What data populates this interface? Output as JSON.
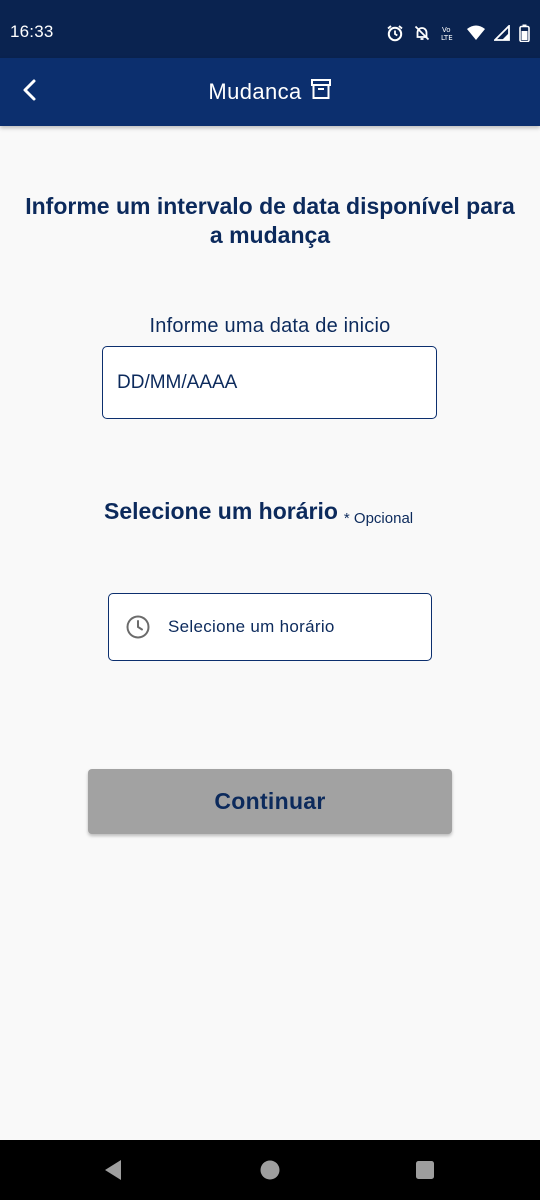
{
  "status_bar": {
    "time": "16:33",
    "icons": [
      "alarm-icon",
      "notifications-off-icon",
      "volte-icon",
      "wifi-icon",
      "signal-icon",
      "battery-icon"
    ]
  },
  "app_bar": {
    "title": "Mudanca",
    "back_icon": "chevron-left-icon",
    "title_icon": "archive-box-icon"
  },
  "main": {
    "heading": "Informe um intervalo de data disponível para a mudança",
    "start_date_label": "Informe uma data de inicio",
    "date_input": {
      "placeholder": "DD/MM/AAAA",
      "value": ""
    },
    "time_heading": "Selecione um horário",
    "optional_label": "* Opcional",
    "time_select": {
      "label": "Selecione um horário",
      "icon": "clock-icon"
    },
    "continue_button": "Continuar"
  },
  "colors": {
    "status_bar_bg": "#0a2350",
    "app_bar_bg": "#0c2f6e",
    "primary_text": "#0c2a5c",
    "disabled_button_bg": "#a2a2a2",
    "page_bg": "#f9f9f9"
  },
  "nav_bar": {
    "buttons": [
      "back-triangle-icon",
      "home-circle-icon",
      "recents-square-icon"
    ]
  }
}
